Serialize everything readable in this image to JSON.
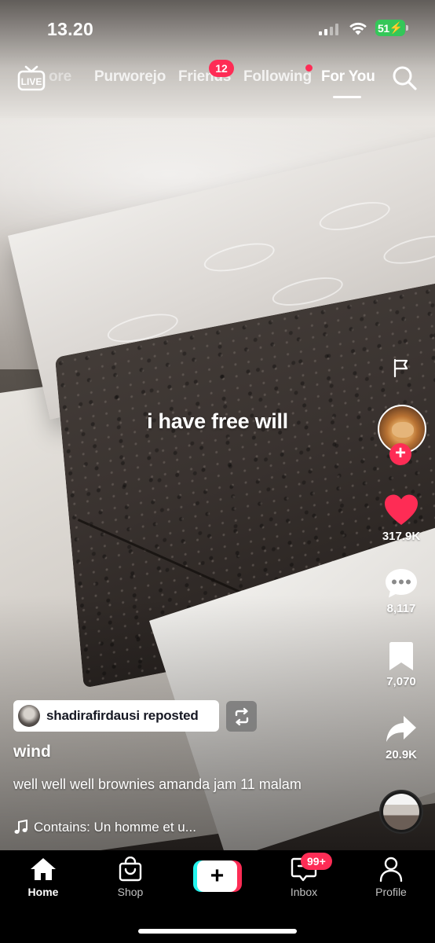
{
  "status_bar": {
    "time": "13.20",
    "battery": "51"
  },
  "top_nav": {
    "live_label": "LIVE",
    "tabs": [
      {
        "label": "ore",
        "active": false
      },
      {
        "label": "Purworejo",
        "active": false
      },
      {
        "label": "Friends",
        "active": false,
        "badge": "12"
      },
      {
        "label": "Following",
        "active": false,
        "dot": true
      },
      {
        "label": "For You",
        "active": true
      }
    ],
    "search_icon": "search-icon"
  },
  "video": {
    "overlay_text": "i have free will"
  },
  "actions": {
    "likes": "317.9K",
    "comments": "8,117",
    "saves": "7,070",
    "shares": "20.9K"
  },
  "post": {
    "repost_text": "shadirafirdausi reposted",
    "username": "wind",
    "caption": "well well well  brownies amanda jam 11 malam",
    "music": "Contains: Un homme et u..."
  },
  "tab_bar": {
    "home": "Home",
    "shop": "Shop",
    "inbox": "Inbox",
    "inbox_badge": "99+",
    "profile": "Profile"
  },
  "colors": {
    "accent": "#fe2c55",
    "cyan": "#25f4ee",
    "battery": "#34c759"
  }
}
